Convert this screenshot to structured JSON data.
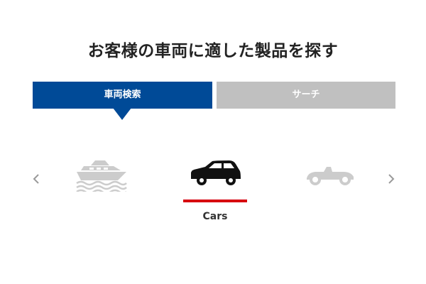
{
  "header": {
    "title": "お客様の車両に適した製品を探す"
  },
  "tabs": [
    {
      "label": "車両検索",
      "active": true
    },
    {
      "label": "サーチ",
      "active": false
    }
  ],
  "carousel": {
    "items": [
      {
        "icon": "boat-icon",
        "selected": false
      },
      {
        "icon": "car-icon",
        "selected": true,
        "label": "Cars"
      },
      {
        "icon": "classic-car-icon",
        "selected": false
      }
    ],
    "prev_icon": "chevron-left-icon",
    "next_icon": "chevron-right-icon"
  },
  "colors": {
    "active_tab": "#004a97",
    "inactive_tab": "#c0c0c0",
    "underline": "#d7000f",
    "inactive_icon": "#cccccc"
  }
}
